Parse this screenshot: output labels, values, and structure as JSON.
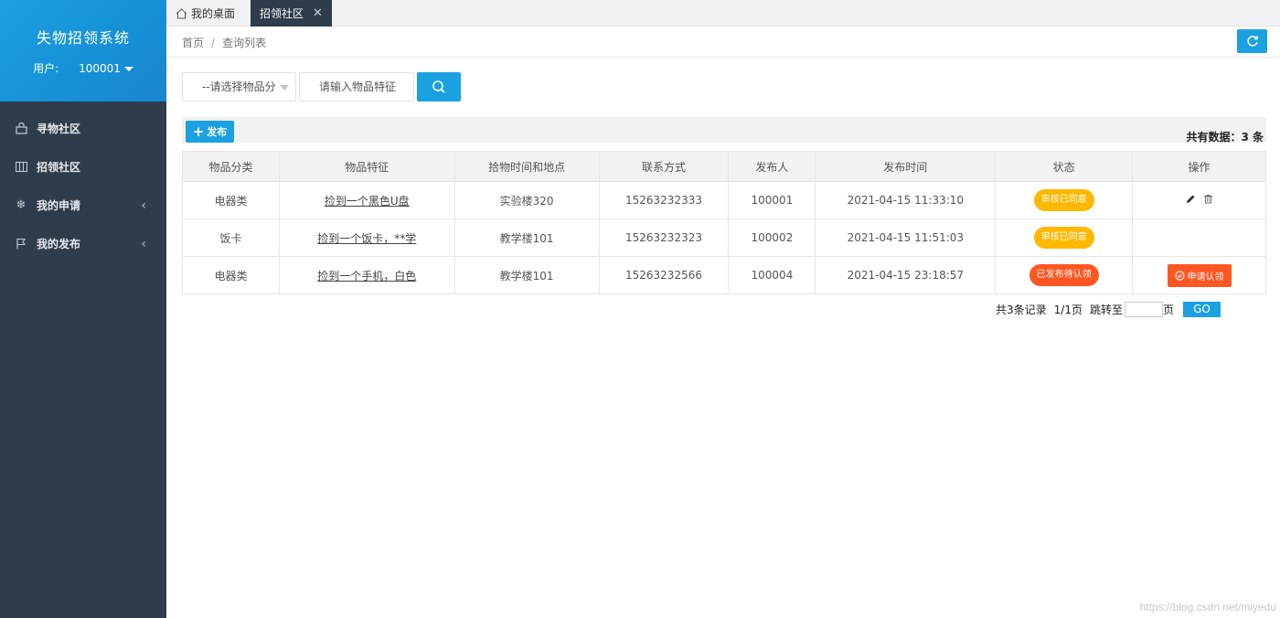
{
  "app": {
    "title": "失物招领系统",
    "user_label": "用户:",
    "user_id": "100001"
  },
  "sidebar": {
    "items": [
      {
        "label": "寻物社区",
        "icon": "shopping-bag-icon"
      },
      {
        "label": "招领社区",
        "icon": "columns-icon"
      },
      {
        "label": "我的申请",
        "icon": "snowflake-icon"
      },
      {
        "label": "我的发布",
        "icon": "flag-icon"
      }
    ]
  },
  "tabs": {
    "home": "我的桌面",
    "active": "招领社区",
    "close": "✕"
  },
  "breadcrumb": {
    "home": "首页",
    "sep": "/",
    "current": "查询列表"
  },
  "search": {
    "select_value": "--请选择物品分",
    "placeholder": "请输入物品特征"
  },
  "toolbar": {
    "add_label": "发布",
    "total": "共有数据：3 条"
  },
  "table": {
    "headers": [
      "物品分类",
      "物品特征",
      "拾物时间和地点",
      "联系方式",
      "发布人",
      "发布时间",
      "状态",
      "操作"
    ],
    "rows": [
      {
        "category": "电器类",
        "feature": "捡到一个黑色U盘",
        "place": "实验楼320",
        "contact": "15263232333",
        "publisher": "100001",
        "time": "2021-04-15 11:33:10",
        "status": "审核已同意"
      },
      {
        "category": "饭卡",
        "feature": "捡到一个饭卡，**学",
        "place": "教学楼101",
        "contact": "15263232323",
        "publisher": "100002",
        "time": "2021-04-15 11:51:03",
        "status": "审核已同意"
      },
      {
        "category": "电器类",
        "feature": "捡到一个手机，白色",
        "place": "教学楼101",
        "contact": "15263232566",
        "publisher": "100004",
        "time": "2021-04-15 23:18:57",
        "status": "已发布待认领",
        "action": "申请认领"
      }
    ]
  },
  "pager": {
    "records": "共3条记录",
    "pages": "1/1页",
    "jump_label": "跳转至",
    "page_unit": "页",
    "go": "GO"
  },
  "watermark": "https://blog.csdn.net/miyedu",
  "colors": {
    "accent": "#1ba1e2",
    "sidebar": "#2f3c4b",
    "status_approved": "#ffb800",
    "status_pending": "#ff5722"
  }
}
